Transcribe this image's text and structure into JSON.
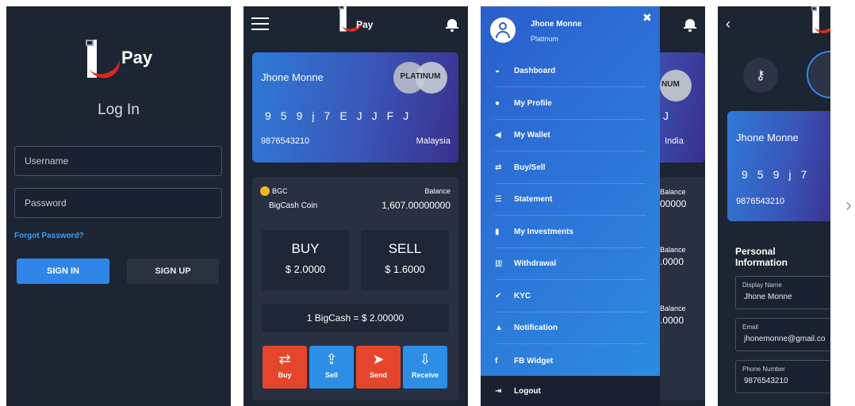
{
  "brand": {
    "logo_text": "Pay"
  },
  "login": {
    "title": "Log In",
    "username_placeholder": "Username",
    "password_placeholder": "Password",
    "forgot": "Forgot Password?",
    "signin": "SIGN IN",
    "signup": "SIGN UP"
  },
  "card": {
    "holder": "Jhone Monne",
    "tier": "PLATINUM",
    "code": [
      "9",
      "5",
      "9",
      "j",
      "7",
      "E",
      "J",
      "J",
      "F",
      "J"
    ],
    "account": "9876543210",
    "country": "Malaysia"
  },
  "wallet": {
    "coin_code": "BGC",
    "coin_name": "BigCash Coin",
    "balance_label": "Balance",
    "balance_value": "1,607.00000000",
    "buy_label": "BUY",
    "buy_price": "$ 2.0000",
    "sell_label": "SELL",
    "sell_price": "$ 1.6000",
    "rate": "1 BigCash = $ 2.00000",
    "actions": [
      {
        "label": "Buy",
        "icon": "transfer-icon",
        "glyph": "⇄"
      },
      {
        "label": "Sell",
        "icon": "sell-icon",
        "glyph": "⇪"
      },
      {
        "label": "Send",
        "icon": "send-icon",
        "glyph": "➤"
      },
      {
        "label": "Receive",
        "icon": "download-icon",
        "glyph": "⇩"
      }
    ]
  },
  "drawer": {
    "user_name": "Jhone Monne",
    "user_tier": "Platinum",
    "close": "✖",
    "items": [
      {
        "label": "Dashboard",
        "icon": "dashboard-icon",
        "glyph": "◒"
      },
      {
        "label": "My Profile",
        "icon": "user-icon",
        "glyph": "●"
      },
      {
        "label": "My Wallet",
        "icon": "wallet-icon",
        "glyph": "◀"
      },
      {
        "label": "Buy/Sell",
        "icon": "exchange-icon",
        "glyph": "⇄"
      },
      {
        "label": "Statement",
        "icon": "list-icon",
        "glyph": "☰"
      },
      {
        "label": "My Investments",
        "icon": "building-icon",
        "glyph": "▮"
      },
      {
        "label": "Withdrawal",
        "icon": "bar-chart-icon",
        "glyph": "▥"
      },
      {
        "label": "KYC",
        "icon": "check-circle-icon",
        "glyph": "✔"
      },
      {
        "label": "Notification",
        "icon": "bell-icon",
        "glyph": "▲"
      },
      {
        "label": "FB Widget",
        "icon": "facebook-icon",
        "glyph": "f"
      }
    ],
    "logout": "Logout",
    "peek_tier": "NUM",
    "peek_code": "J",
    "peek_country": "India",
    "peek_balance_label": "Balance",
    "peek_values": [
      "00000",
      ".0000",
      ".0000"
    ]
  },
  "profile": {
    "card_holder": "Jhone Monne",
    "card_code": [
      "9",
      "5",
      "9",
      "j",
      "7"
    ],
    "card_account": "9876543210",
    "section_title": "Personal Information",
    "fields": [
      {
        "label": "Display Name",
        "value": "Jhone Monne"
      },
      {
        "label": "Email",
        "value": "jhonemonne@gmail.co"
      },
      {
        "label": "Phone Number",
        "value": "9876543210"
      }
    ]
  },
  "gallery": {
    "next_glyph": "›"
  }
}
